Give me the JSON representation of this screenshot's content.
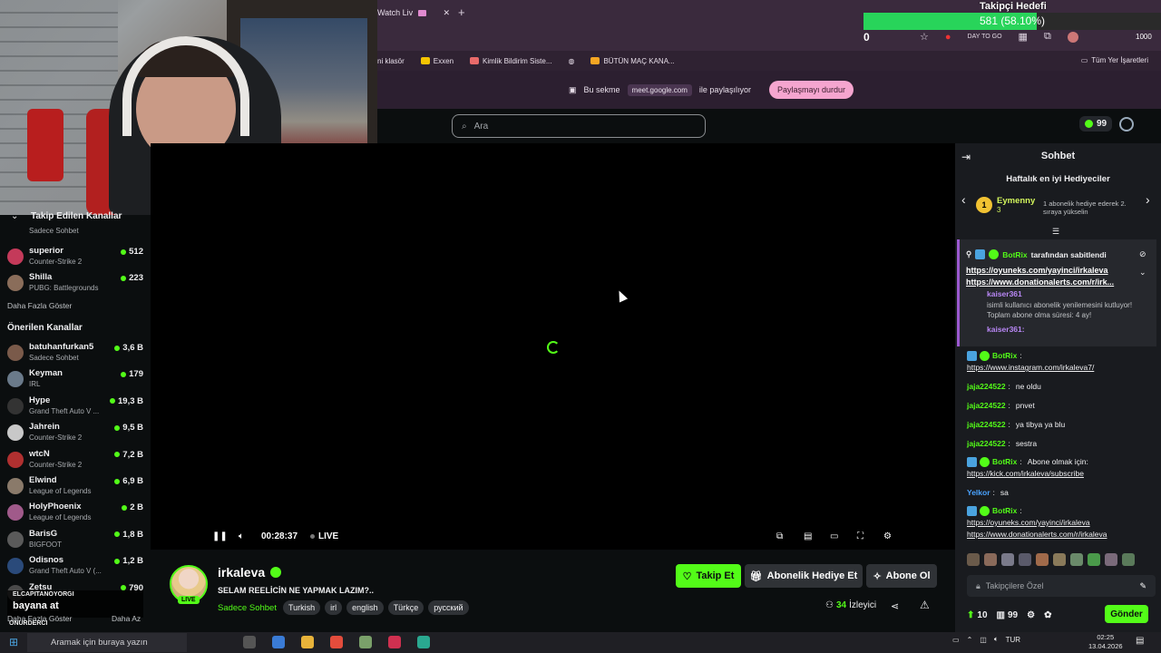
{
  "browser": {
    "tab_title": "Watch Liv",
    "new_tab": "+",
    "bookmarks": [
      {
        "label": "ni klasör",
        "color": "#f3b43f"
      },
      {
        "label": "Exxen",
        "color": "#f5c400"
      },
      {
        "label": "Kimlik Bildirim Siste...",
        "color": "#e86a6a"
      },
      {
        "label": "",
        "color": "#888888"
      },
      {
        "label": "BÜTÜN MAÇ KANA...",
        "color": "#f5a623"
      }
    ],
    "bookmarks_right": "Tüm Yer İşaretleri",
    "share_text": "Bu sekme",
    "share_url": "meet.google.com",
    "share_text2": "ile paylaşılıyor",
    "stop_share": "Paylaşmayı durdur",
    "address_icons_text": "DAY TO GO"
  },
  "goal": {
    "title": "Takipçi Hedefi",
    "progress_text": "581 (58.10%)",
    "fraction": 0.581,
    "start": "0",
    "max": "1000"
  },
  "header": {
    "search_placeholder": "Ara",
    "points": "99"
  },
  "sidebar": {
    "followed_title": "Takip Edilen Kanallar",
    "followed_partial_cat": "Sadece Sohbet",
    "followed": [
      {
        "name": "superior",
        "category": "Counter-Strike 2",
        "viewers": "512",
        "color": "#c43a5a"
      },
      {
        "name": "Shilla",
        "category": "PUBG: Battlegrounds",
        "viewers": "223",
        "color": "#8a6d5a"
      }
    ],
    "show_more": "Daha Fazla Göster",
    "recommended_title": "Önerilen Kanallar",
    "recommended": [
      {
        "name": "batuhanfurkan5",
        "category": "Sadece Sohbet",
        "viewers": "3,6 B",
        "color": "#7a5a4a"
      },
      {
        "name": "Keyman",
        "category": "IRL",
        "viewers": "179",
        "color": "#6a7a8a"
      },
      {
        "name": "Hype",
        "category": "Grand Theft Auto V ...",
        "viewers": "19,3 B",
        "color": "#333333"
      },
      {
        "name": "Jahrein",
        "category": "Counter-Strike 2",
        "viewers": "9,5 B",
        "color": "#c8c8c8"
      },
      {
        "name": "wtcN",
        "category": "Counter-Strike 2",
        "viewers": "7,2 B",
        "color": "#b03030"
      },
      {
        "name": "Elwind",
        "category": "League of Legends",
        "viewers": "6,9 B",
        "color": "#8a7a6a"
      },
      {
        "name": "HolyPhoenix",
        "category": "League of Legends",
        "viewers": "2 B",
        "color": "#a05a8a"
      },
      {
        "name": "BarisG",
        "category": "BIGFOOT",
        "viewers": "1,8 B",
        "color": "#5a5a5a"
      },
      {
        "name": "Odisnos",
        "category": "Grand Theft Auto V (...",
        "viewers": "1,2 B",
        "color": "#2a4a7a"
      },
      {
        "name": "Zetsu",
        "category": "",
        "viewers": "790",
        "color": "#4a4a4a"
      }
    ],
    "show_more_bottom": "Daha Fazla Göster",
    "show_less": "Daha Az"
  },
  "player": {
    "time": "00:28:37",
    "live": "LIVE"
  },
  "stream": {
    "name": "irkaleva",
    "live_badge": "LIVE",
    "title": "SELAM REELİCİN NE YAPMAK LAZIM?..",
    "category": "Sadece Sohbet",
    "tags": [
      "Turkish",
      "irl",
      "english",
      "Türkçe",
      "русский"
    ],
    "follow": "Takip Et",
    "gift_sub": "Abonelik Hediye Et",
    "subscribe": "Abone Ol",
    "viewers_count": "34",
    "viewers_label": "İzleyici"
  },
  "chat": {
    "title": "Sohbet",
    "gifters_title": "Haftalık en iyi Hediyeciler",
    "top_gifter": {
      "rank": "1",
      "name": "Eymenny",
      "count": "3"
    },
    "gifter_note": "1 abonelik hediye ederek 2. sıraya yükselin",
    "pinned": {
      "header": "tarafından sabitlendi",
      "bot": "BotRix",
      "link1": "https://oyuneks.com/yayinci/irkaleva",
      "link2": "https://www.donationalerts.com/r/irk...",
      "event_user": "kaiser361",
      "event_text": "isimli kullanıcı abonelik yenilemesini kutluyor! Toplam abone olma süresi: 4 ay!",
      "event_user2": "kaiser361:"
    },
    "messages": [
      {
        "user": "BotRix",
        "color": "#53fc18",
        "text": "",
        "link": "https://www.instagram.com/irkaleva7/",
        "bot": true
      },
      {
        "user": "jaja224522",
        "color": "#53fc18",
        "text": "ne oldu",
        "link": "",
        "bot": false
      },
      {
        "user": "jaja224522",
        "color": "#53fc18",
        "text": "pnvet",
        "link": "",
        "bot": false
      },
      {
        "user": "jaja224522",
        "color": "#53fc18",
        "text": "ya tibya ya blu",
        "link": "",
        "bot": false
      },
      {
        "user": "jaja224522",
        "color": "#53fc18",
        "text": "sestra",
        "link": "",
        "bot": false
      },
      {
        "user": "BotRix",
        "color": "#53fc18",
        "text": "Abone olmak için:",
        "link": "https://kick.com/irkaleva/subscribe",
        "bot": true
      },
      {
        "user": "Yelkor",
        "color": "#4aa3ff",
        "text": "sa",
        "link": "",
        "bot": false
      },
      {
        "user": "BotRix",
        "color": "#53fc18",
        "text": "",
        "link": "https://oyuneks.com/yayinci/irkaleva",
        "link2": "https://www.donationalerts.com/r/irkaleva",
        "bot": true
      }
    ],
    "input_placeholder": "Takipçilere Özel",
    "footer_points": "10",
    "footer_store": "99",
    "send": "Gönder"
  },
  "alert": {
    "user": "ELCAPITANOYORGI",
    "message": "bayana at",
    "user2": "ONURDERCI"
  },
  "taskbar": {
    "search": "Aramak için buraya yazın",
    "lang": "TUR",
    "time": "02:25",
    "date": "13.04.2026"
  }
}
